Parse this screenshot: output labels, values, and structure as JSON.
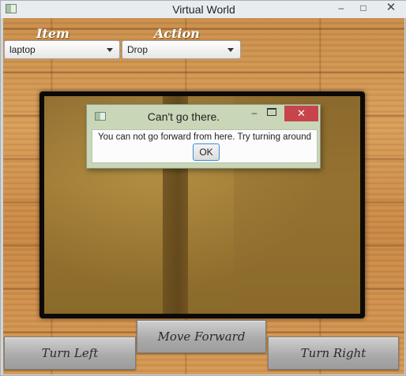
{
  "window": {
    "title": "Virtual World",
    "minimize_glyph": "–",
    "maximize_glyph": "□",
    "close_glyph": "✕"
  },
  "controls": {
    "item_label": "Item",
    "action_label": "Action",
    "item_selected": "laptop",
    "action_selected": "Drop"
  },
  "dialog": {
    "title": "Can't go there.",
    "message": "You can not go forward from here. Try turning around",
    "ok_label": "OK",
    "minimize_glyph": "–",
    "close_glyph": "✕"
  },
  "navigation": {
    "turn_left": "Turn Left",
    "move_forward": "Move Forward",
    "turn_right": "Turn Right"
  }
}
